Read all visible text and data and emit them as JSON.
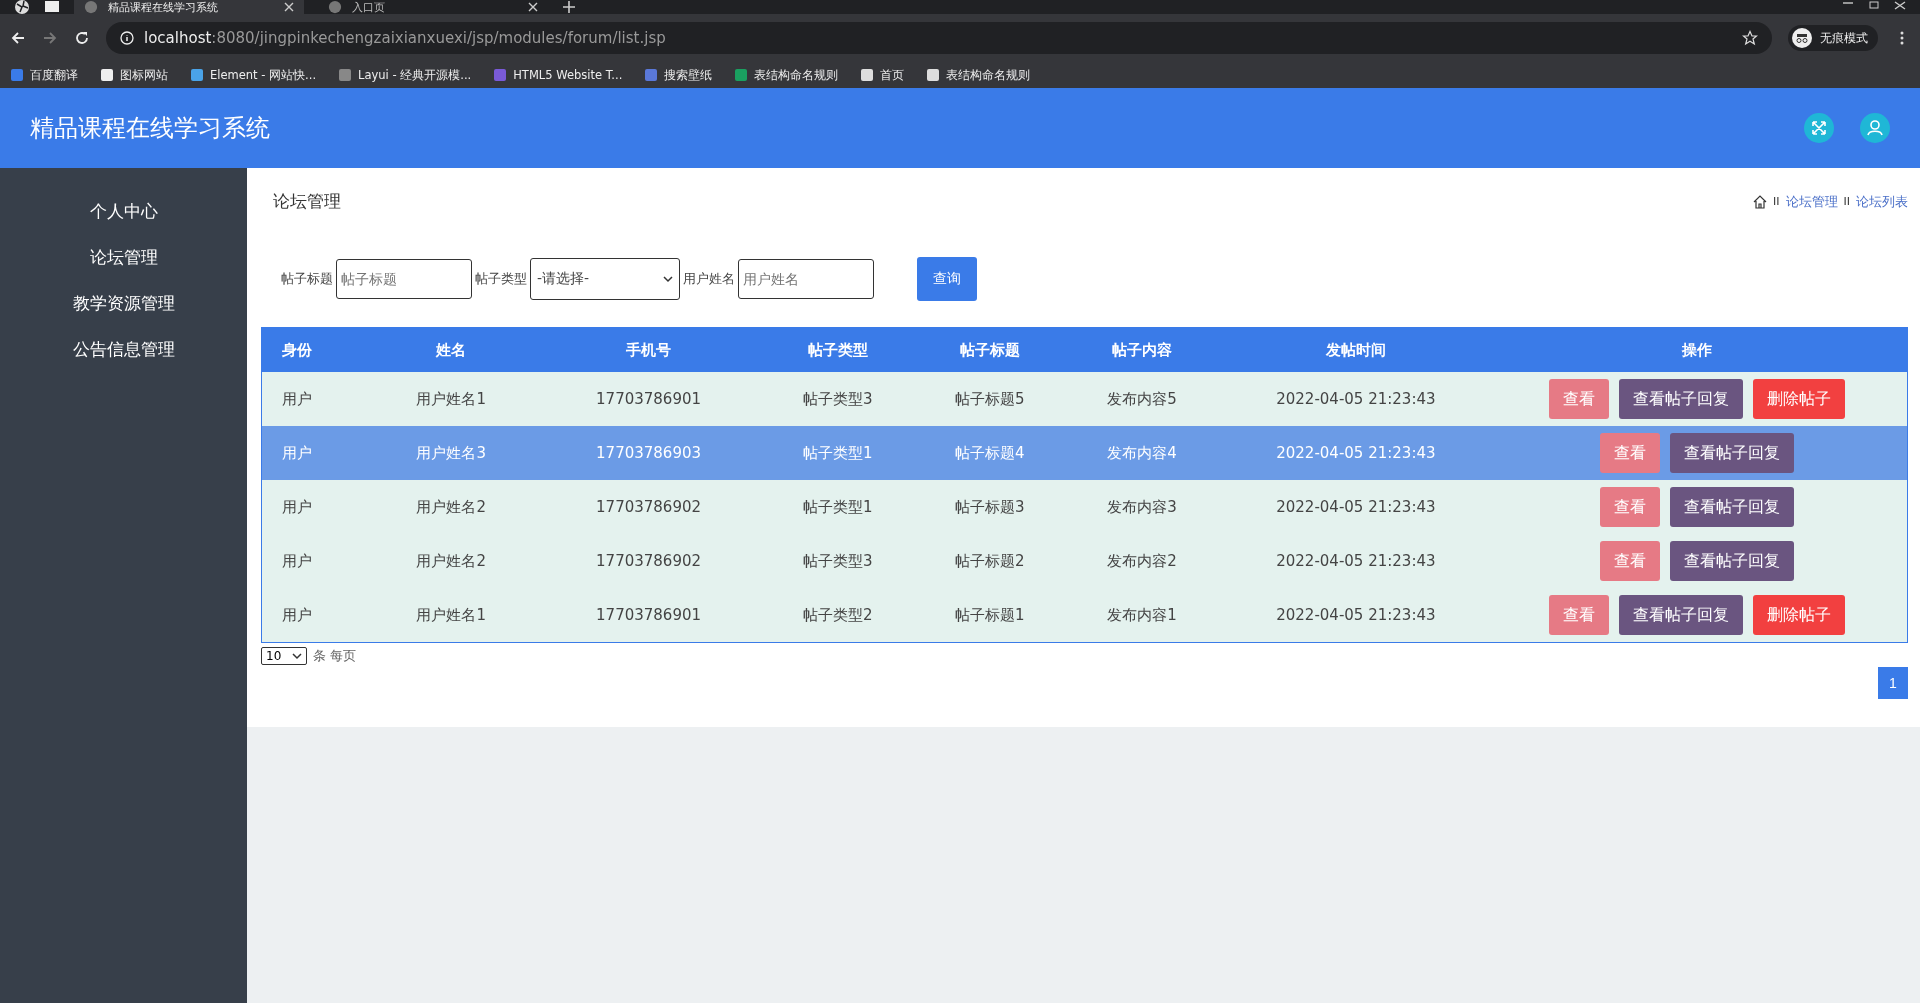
{
  "browser": {
    "tabs": [
      {
        "title": "精品课程在线学习系统",
        "selected": true
      },
      {
        "title": "入口页",
        "selected": false
      }
    ],
    "url_host": "localhost",
    "url_rest": ":8080/jingpinkechengzaixianxuexi/jsp/modules/forum/list.jsp",
    "profile": "无痕模式",
    "bookmarks": [
      "百度翻译",
      "图标网站",
      "Element - 网站快...",
      "Layui - 经典开源模...",
      "HTML5 Website T...",
      "搜索壁纸",
      "表结构命名规则",
      "首页",
      "表结构命名规则"
    ]
  },
  "app_title": "精品课程在线学习系统",
  "sidebar": {
    "items": [
      "个人中心",
      "论坛管理",
      "教学资源管理",
      "公告信息管理"
    ]
  },
  "page_title": "论坛管理",
  "breadcrumb": [
    "论坛管理",
    "论坛列表"
  ],
  "breadcrumb_separators": [
    "II",
    "II"
  ],
  "filters": [
    {
      "label": "帖子标题",
      "kind": "text",
      "placeholder": "帖子标题"
    },
    {
      "label": "帖子类型",
      "kind": "select",
      "value": "-请选择-"
    },
    {
      "label": "用户姓名",
      "kind": "text",
      "placeholder": "用户姓名"
    }
  ],
  "search_button": "查询",
  "table": {
    "columns": [
      "身份",
      "姓名",
      "手机号",
      "帖子类型",
      "帖子标题",
      "帖子内容",
      "发帖时间",
      "操作"
    ],
    "rows": [
      {
        "selected": false,
        "cells": [
          "用户",
          "用户姓名1",
          "17703786901",
          "帖子类型3",
          "帖子标题5",
          "发布内容5",
          "2022-04-05 21:23:43"
        ],
        "actions": [
          {
            "label": "查看",
            "kind": "view"
          },
          {
            "label": "查看帖子回复",
            "kind": "replies"
          },
          {
            "label": "删除帖子",
            "kind": "delete"
          }
        ]
      },
      {
        "selected": true,
        "cells": [
          "用户",
          "用户姓名3",
          "17703786903",
          "帖子类型1",
          "帖子标题4",
          "发布内容4",
          "2022-04-05 21:23:43"
        ],
        "actions": [
          {
            "label": "查看",
            "kind": "view"
          },
          {
            "label": "查看帖子回复",
            "kind": "replies"
          }
        ]
      },
      {
        "selected": false,
        "cells": [
          "用户",
          "用户姓名2",
          "17703786902",
          "帖子类型1",
          "帖子标题3",
          "发布内容3",
          "2022-04-05 21:23:43"
        ],
        "actions": [
          {
            "label": "查看",
            "kind": "view"
          },
          {
            "label": "查看帖子回复",
            "kind": "replies"
          }
        ]
      },
      {
        "selected": false,
        "cells": [
          "用户",
          "用户姓名2",
          "17703786902",
          "帖子类型3",
          "帖子标题2",
          "发布内容2",
          "2022-04-05 21:23:43"
        ],
        "actions": [
          {
            "label": "查看",
            "kind": "view"
          },
          {
            "label": "查看帖子回复",
            "kind": "replies"
          }
        ]
      },
      {
        "selected": false,
        "cells": [
          "用户",
          "用户姓名1",
          "17703786901",
          "帖子类型2",
          "帖子标题1",
          "发布内容1",
          "2022-04-05 21:23:43"
        ],
        "actions": [
          {
            "label": "查看",
            "kind": "view"
          },
          {
            "label": "查看帖子回复",
            "kind": "replies"
          },
          {
            "label": "删除帖子",
            "kind": "delete"
          }
        ]
      }
    ]
  },
  "page_size": "10",
  "page_size_label": "条 每页",
  "pages": [
    {
      "label": "1",
      "selected": true
    }
  ]
}
